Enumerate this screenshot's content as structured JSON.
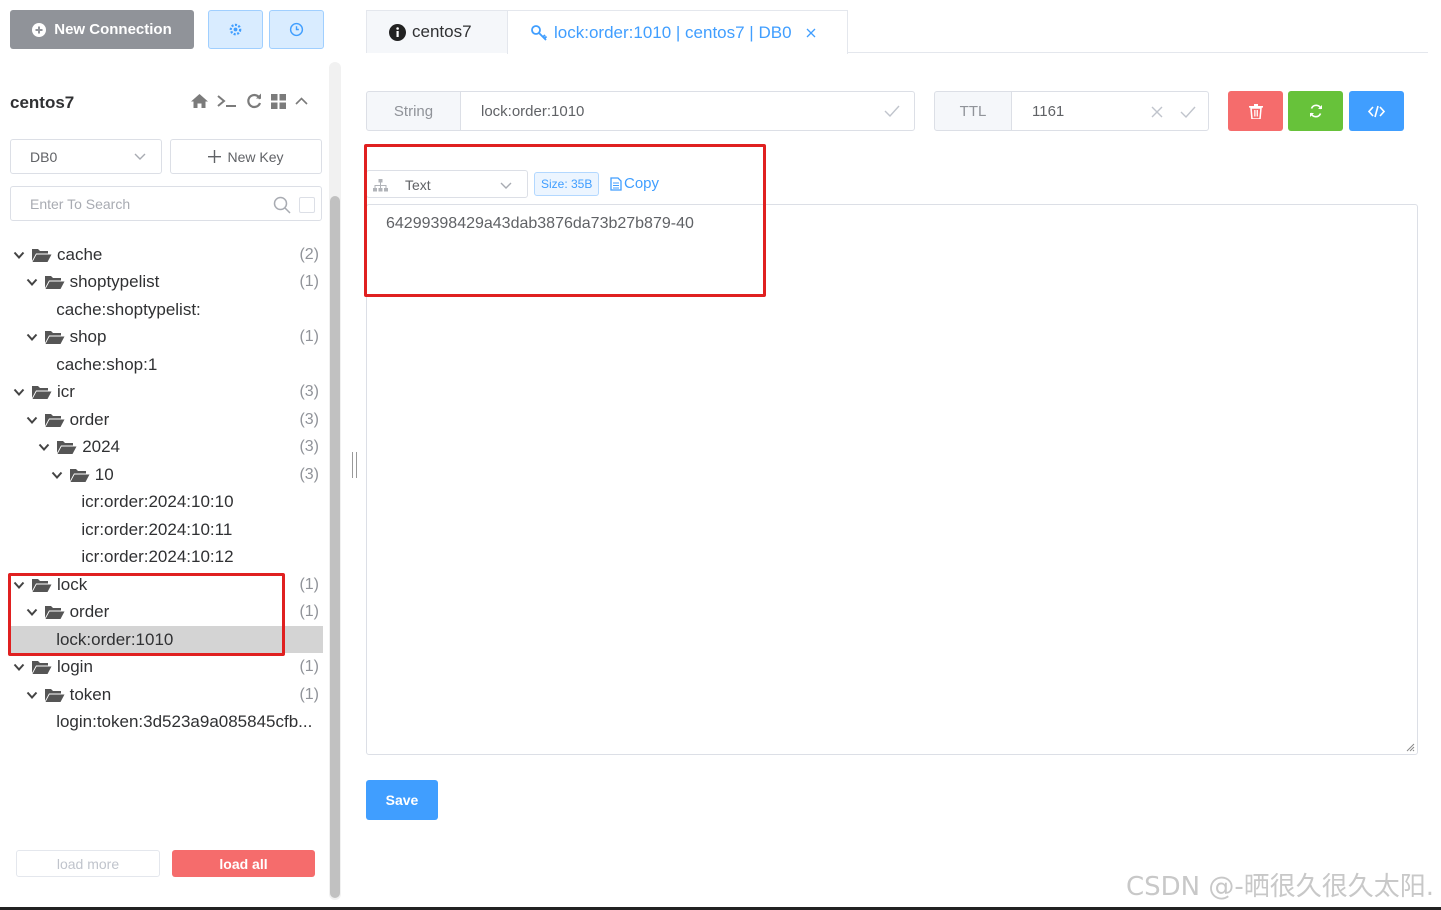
{
  "sidebar": {
    "new_connection_label": "New Connection",
    "connection_name": "centos7",
    "db_select": "DB0",
    "new_key_label": "New Key",
    "search_placeholder": "Enter To Search",
    "tree": [
      {
        "label": "cache",
        "count": "(2)",
        "level": 0,
        "folder": true
      },
      {
        "label": "shoptypelist",
        "count": "(1)",
        "level": 1,
        "folder": true
      },
      {
        "label": "cache:shoptypelist:",
        "count": "",
        "level": 2,
        "folder": false
      },
      {
        "label": "shop",
        "count": "(1)",
        "level": 1,
        "folder": true
      },
      {
        "label": "cache:shop:1",
        "count": "",
        "level": 2,
        "folder": false
      },
      {
        "label": "icr",
        "count": "(3)",
        "level": 0,
        "folder": true
      },
      {
        "label": "order",
        "count": "(3)",
        "level": 1,
        "folder": true
      },
      {
        "label": "2024",
        "count": "(3)",
        "level": 2,
        "folder": true
      },
      {
        "label": "10",
        "count": "(3)",
        "level": 3,
        "folder": true
      },
      {
        "label": "icr:order:2024:10:10",
        "count": "",
        "level": 4,
        "folder": false
      },
      {
        "label": "icr:order:2024:10:11",
        "count": "",
        "level": 4,
        "folder": false
      },
      {
        "label": "icr:order:2024:10:12",
        "count": "",
        "level": 4,
        "folder": false
      },
      {
        "label": "lock",
        "count": "(1)",
        "level": 0,
        "folder": true
      },
      {
        "label": "order",
        "count": "(1)",
        "level": 1,
        "folder": true
      },
      {
        "label": "lock:order:1010",
        "count": "",
        "level": 2,
        "folder": false,
        "selected": true
      },
      {
        "label": "login",
        "count": "(1)",
        "level": 0,
        "folder": true
      },
      {
        "label": "token",
        "count": "(1)",
        "level": 1,
        "folder": true
      },
      {
        "label": "login:token:3d523a9a085845cfb...",
        "count": "",
        "level": 2,
        "folder": false
      }
    ],
    "load_more_label": "load more",
    "load_all_label": "load all"
  },
  "tabs": [
    {
      "label": "centos7",
      "icon": "info-icon",
      "active": false
    },
    {
      "label": "lock:order:1010 | centos7 | DB0",
      "icon": "key-icon",
      "active": true
    }
  ],
  "key_detail": {
    "type": "String",
    "key_name": "lock:order:1010",
    "ttl_label": "TTL",
    "ttl_value": "1161",
    "format": "Text",
    "size": "Size: 35B",
    "copy_label": "Copy",
    "value": "64299398429a43dab3876da73b27b879-40",
    "save_label": "Save"
  },
  "colors": {
    "primary": "#409eff",
    "danger": "#f56c6c",
    "success": "#67c23a",
    "annotation": "#e02020"
  },
  "watermark": "CSDN @-晒很久很久太阳."
}
